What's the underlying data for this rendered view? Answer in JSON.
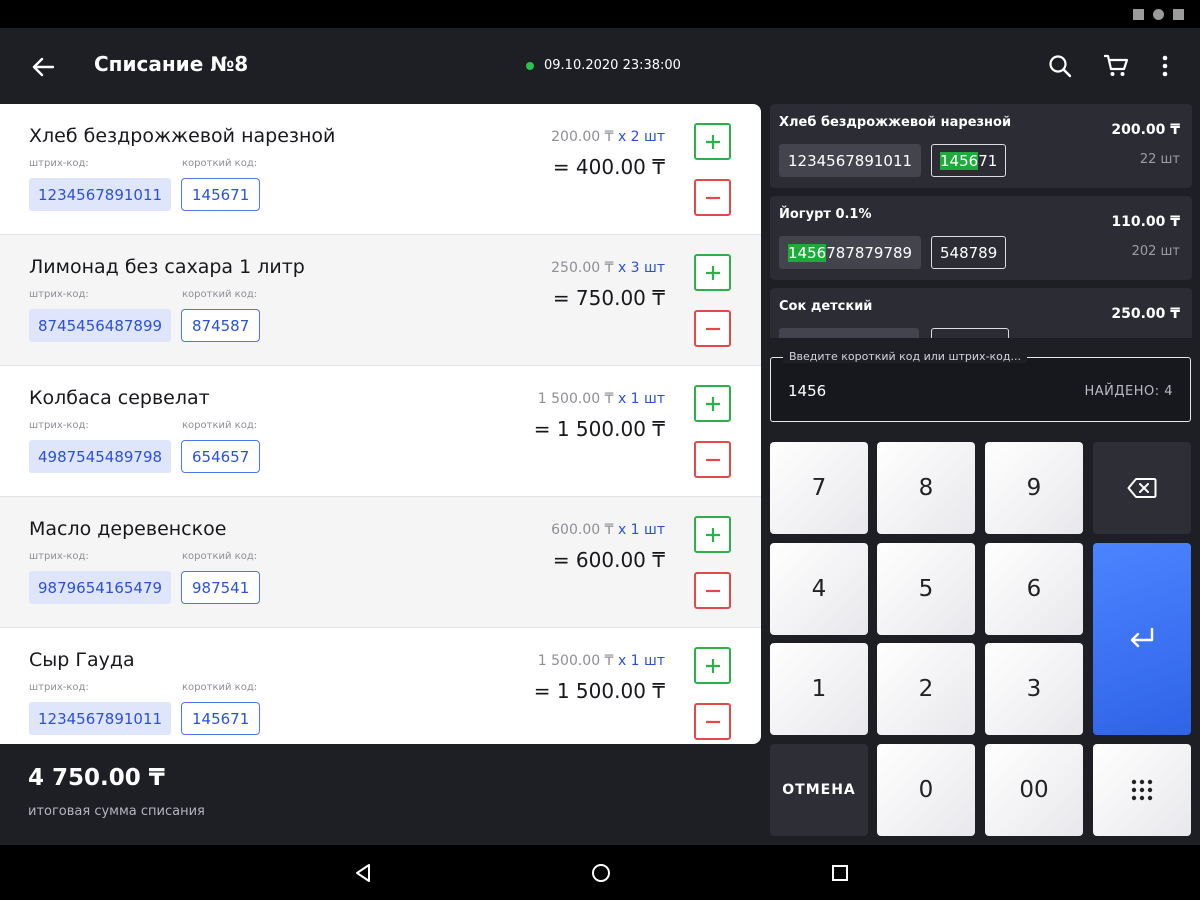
{
  "header": {
    "title": "Списание №8",
    "datetime": "09.10.2020 23:38:00",
    "icons": [
      "arrow-back-icon",
      "search-icon",
      "cart-icon",
      "more-vertical-icon"
    ]
  },
  "items": [
    {
      "name": "Хлеб бездрожжевой нарезной",
      "barcode_label": "штрих-код:",
      "short_label": "короткий код:",
      "barcode": "1234567891011",
      "short_code": "145671",
      "price": "200.00 ₸",
      "qty": "x 2 шт",
      "total": "= 400.00 ₸"
    },
    {
      "name": "Лимонад без сахара 1 литр",
      "barcode_label": "штрих-код:",
      "short_label": "короткий код:",
      "barcode": "8745456487899",
      "short_code": "874587",
      "price": "250.00 ₸",
      "qty": "x 3 шт",
      "total": "= 750.00 ₸"
    },
    {
      "name": "Колбаса сервелат",
      "barcode_label": "штрих-код:",
      "short_label": "короткий код:",
      "barcode": "4987545489798",
      "short_code": "654657",
      "price": "1 500.00 ₸",
      "qty": "x 1 шт",
      "total": "= 1 500.00 ₸"
    },
    {
      "name": "Масло деревенское",
      "barcode_label": "штрих-код:",
      "short_label": "короткий код:",
      "barcode": "9879654165479",
      "short_code": "987541",
      "price": "600.00 ₸",
      "qty": "x 1 шт",
      "total": "= 600.00 ₸"
    },
    {
      "name": "Сыр Гауда",
      "barcode_label": "штрих-код:",
      "short_label": "короткий код:",
      "barcode": "1234567891011",
      "short_code": "145671",
      "price": "1 500.00 ₸",
      "qty": "x 1 шт",
      "total": "= 1 500.00 ₸"
    }
  ],
  "summary": {
    "total": "4 750.00 ₸",
    "total_label": "итоговая сумма списания"
  },
  "results": [
    {
      "name": "Хлеб бездрожжевой нарезной",
      "price": "200.00 ₸",
      "stock": "22 шт",
      "barcode_hl": "",
      "barcode_rest": "1234567891011",
      "short_hl": "1456",
      "short_rest": "71"
    },
    {
      "name": "Йогурт  0.1%",
      "price": "110.00 ₸",
      "stock": "202 шт",
      "barcode_hl": "1456",
      "barcode_rest": "787879789",
      "short_hl": "",
      "short_rest": "548789"
    },
    {
      "name": "Сок детский",
      "price": "250.00 ₸",
      "stock": "",
      "barcode_hl": "",
      "barcode_rest": "",
      "short_hl": "",
      "short_rest": ""
    }
  ],
  "search": {
    "label": "Введите короткий код или штрих-код...",
    "value": "1456",
    "found": "НАЙДЕНО: 4"
  },
  "keypad": {
    "k7": "7",
    "k8": "8",
    "k9": "9",
    "k4": "4",
    "k5": "5",
    "k6": "6",
    "k1": "1",
    "k2": "2",
    "k3": "3",
    "cancel": "ОТМЕНА",
    "k0": "0",
    "k00": "00"
  },
  "colors": {
    "accent_blue": "#2f63e8",
    "plus_green": "#2bb04a",
    "minus_red": "#e24a4a",
    "highlight_green": "#1faa3c"
  }
}
